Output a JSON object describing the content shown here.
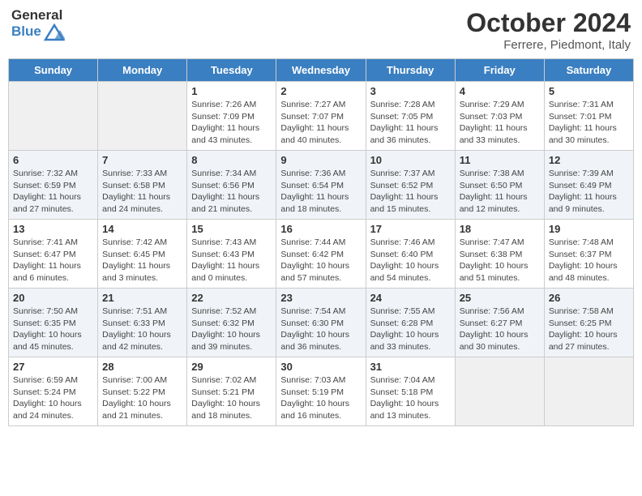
{
  "header": {
    "logo_general": "General",
    "logo_blue": "Blue",
    "month": "October 2024",
    "location": "Ferrere, Piedmont, Italy"
  },
  "days_of_week": [
    "Sunday",
    "Monday",
    "Tuesday",
    "Wednesday",
    "Thursday",
    "Friday",
    "Saturday"
  ],
  "weeks": [
    [
      {
        "day": "",
        "info": ""
      },
      {
        "day": "",
        "info": ""
      },
      {
        "day": "1",
        "info": "Sunrise: 7:26 AM\nSunset: 7:09 PM\nDaylight: 11 hours and 43 minutes."
      },
      {
        "day": "2",
        "info": "Sunrise: 7:27 AM\nSunset: 7:07 PM\nDaylight: 11 hours and 40 minutes."
      },
      {
        "day": "3",
        "info": "Sunrise: 7:28 AM\nSunset: 7:05 PM\nDaylight: 11 hours and 36 minutes."
      },
      {
        "day": "4",
        "info": "Sunrise: 7:29 AM\nSunset: 7:03 PM\nDaylight: 11 hours and 33 minutes."
      },
      {
        "day": "5",
        "info": "Sunrise: 7:31 AM\nSunset: 7:01 PM\nDaylight: 11 hours and 30 minutes."
      }
    ],
    [
      {
        "day": "6",
        "info": "Sunrise: 7:32 AM\nSunset: 6:59 PM\nDaylight: 11 hours and 27 minutes."
      },
      {
        "day": "7",
        "info": "Sunrise: 7:33 AM\nSunset: 6:58 PM\nDaylight: 11 hours and 24 minutes."
      },
      {
        "day": "8",
        "info": "Sunrise: 7:34 AM\nSunset: 6:56 PM\nDaylight: 11 hours and 21 minutes."
      },
      {
        "day": "9",
        "info": "Sunrise: 7:36 AM\nSunset: 6:54 PM\nDaylight: 11 hours and 18 minutes."
      },
      {
        "day": "10",
        "info": "Sunrise: 7:37 AM\nSunset: 6:52 PM\nDaylight: 11 hours and 15 minutes."
      },
      {
        "day": "11",
        "info": "Sunrise: 7:38 AM\nSunset: 6:50 PM\nDaylight: 11 hours and 12 minutes."
      },
      {
        "day": "12",
        "info": "Sunrise: 7:39 AM\nSunset: 6:49 PM\nDaylight: 11 hours and 9 minutes."
      }
    ],
    [
      {
        "day": "13",
        "info": "Sunrise: 7:41 AM\nSunset: 6:47 PM\nDaylight: 11 hours and 6 minutes."
      },
      {
        "day": "14",
        "info": "Sunrise: 7:42 AM\nSunset: 6:45 PM\nDaylight: 11 hours and 3 minutes."
      },
      {
        "day": "15",
        "info": "Sunrise: 7:43 AM\nSunset: 6:43 PM\nDaylight: 11 hours and 0 minutes."
      },
      {
        "day": "16",
        "info": "Sunrise: 7:44 AM\nSunset: 6:42 PM\nDaylight: 10 hours and 57 minutes."
      },
      {
        "day": "17",
        "info": "Sunrise: 7:46 AM\nSunset: 6:40 PM\nDaylight: 10 hours and 54 minutes."
      },
      {
        "day": "18",
        "info": "Sunrise: 7:47 AM\nSunset: 6:38 PM\nDaylight: 10 hours and 51 minutes."
      },
      {
        "day": "19",
        "info": "Sunrise: 7:48 AM\nSunset: 6:37 PM\nDaylight: 10 hours and 48 minutes."
      }
    ],
    [
      {
        "day": "20",
        "info": "Sunrise: 7:50 AM\nSunset: 6:35 PM\nDaylight: 10 hours and 45 minutes."
      },
      {
        "day": "21",
        "info": "Sunrise: 7:51 AM\nSunset: 6:33 PM\nDaylight: 10 hours and 42 minutes."
      },
      {
        "day": "22",
        "info": "Sunrise: 7:52 AM\nSunset: 6:32 PM\nDaylight: 10 hours and 39 minutes."
      },
      {
        "day": "23",
        "info": "Sunrise: 7:54 AM\nSunset: 6:30 PM\nDaylight: 10 hours and 36 minutes."
      },
      {
        "day": "24",
        "info": "Sunrise: 7:55 AM\nSunset: 6:28 PM\nDaylight: 10 hours and 33 minutes."
      },
      {
        "day": "25",
        "info": "Sunrise: 7:56 AM\nSunset: 6:27 PM\nDaylight: 10 hours and 30 minutes."
      },
      {
        "day": "26",
        "info": "Sunrise: 7:58 AM\nSunset: 6:25 PM\nDaylight: 10 hours and 27 minutes."
      }
    ],
    [
      {
        "day": "27",
        "info": "Sunrise: 6:59 AM\nSunset: 5:24 PM\nDaylight: 10 hours and 24 minutes."
      },
      {
        "day": "28",
        "info": "Sunrise: 7:00 AM\nSunset: 5:22 PM\nDaylight: 10 hours and 21 minutes."
      },
      {
        "day": "29",
        "info": "Sunrise: 7:02 AM\nSunset: 5:21 PM\nDaylight: 10 hours and 18 minutes."
      },
      {
        "day": "30",
        "info": "Sunrise: 7:03 AM\nSunset: 5:19 PM\nDaylight: 10 hours and 16 minutes."
      },
      {
        "day": "31",
        "info": "Sunrise: 7:04 AM\nSunset: 5:18 PM\nDaylight: 10 hours and 13 minutes."
      },
      {
        "day": "",
        "info": ""
      },
      {
        "day": "",
        "info": ""
      }
    ]
  ]
}
